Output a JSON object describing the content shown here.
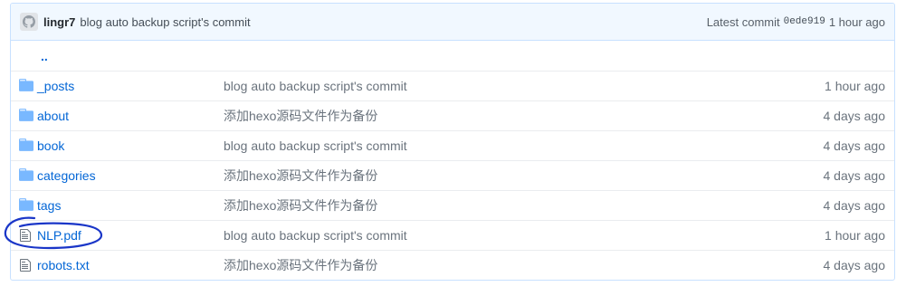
{
  "commit_bar": {
    "author": "lingr7",
    "message": "blog auto backup script's commit",
    "latest_label": "Latest commit",
    "sha": "0ede919",
    "age": "1 hour ago"
  },
  "parent_link": "..",
  "files": [
    {
      "type": "folder",
      "icon": "folder-icon",
      "name": "_posts",
      "message": "blog auto backup script's commit",
      "age": "1 hour ago"
    },
    {
      "type": "folder",
      "icon": "folder-icon",
      "name": "about",
      "message": "添加hexo源码文件作为备份",
      "age": "4 days ago"
    },
    {
      "type": "folder",
      "icon": "folder-icon",
      "name": "book",
      "message": "blog auto backup script's commit",
      "age": "4 days ago"
    },
    {
      "type": "folder",
      "icon": "folder-icon",
      "name": "categories",
      "message": "添加hexo源码文件作为备份",
      "age": "4 days ago"
    },
    {
      "type": "folder",
      "icon": "folder-icon",
      "name": "tags",
      "message": "添加hexo源码文件作为备份",
      "age": "4 days ago"
    },
    {
      "type": "file",
      "icon": "file-icon",
      "name": "NLP.pdf",
      "message": "blog auto backup script's commit",
      "age": "1 hour ago"
    },
    {
      "type": "file",
      "icon": "file-icon",
      "name": "robots.txt",
      "message": "添加hexo源码文件作为备份",
      "age": "4 days ago"
    }
  ],
  "colors": {
    "header_bg": "#f1f8ff",
    "border": "#c8e1ff",
    "link": "#0366d6",
    "folder": "#79b8ff",
    "annotation": "#1a36c8"
  }
}
